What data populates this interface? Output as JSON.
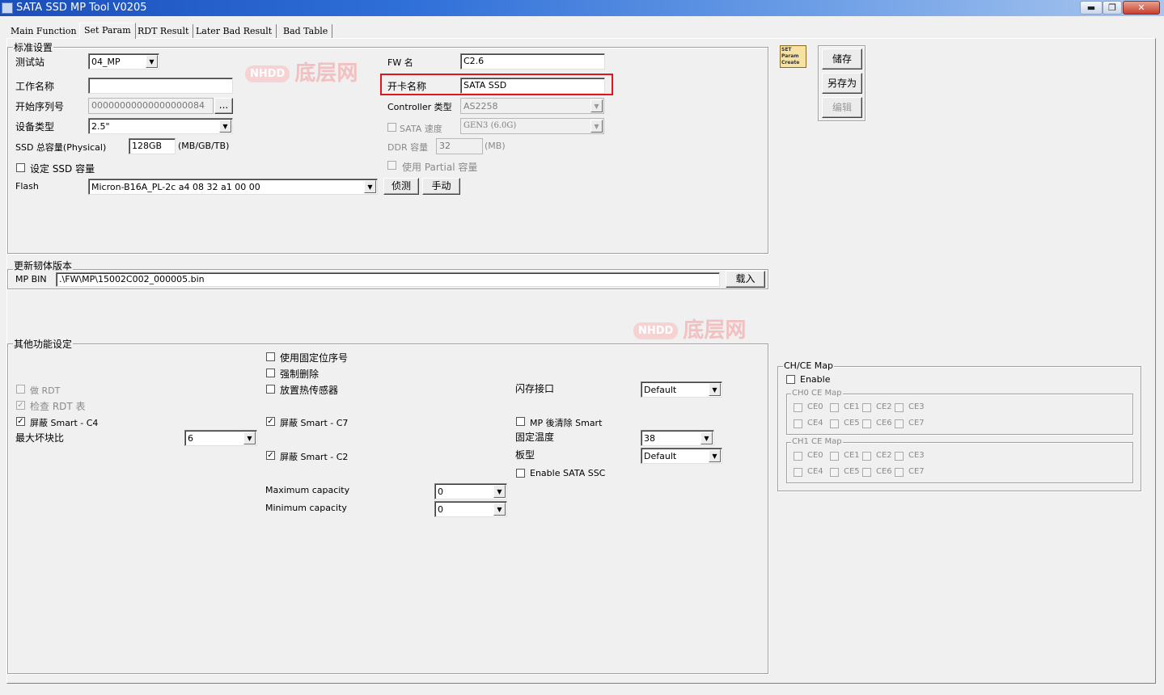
{
  "window": {
    "title": "SATA SSD MP Tool V0205",
    "minimize": "▬",
    "maximize": "❐",
    "close": "✕"
  },
  "tabs": [
    "Main Function",
    "Set Param",
    "RDT Result",
    "Later Bad Result",
    "Bad Table"
  ],
  "standard": {
    "legend": "标准设置",
    "station_label": "测试站",
    "station_value": "04_MP",
    "work_name_label": "工作名称",
    "work_name_value": "",
    "serial_label": "开始序列号",
    "serial_value": "00000000000000000084",
    "serial_browse": "...",
    "device_type_label": "设备类型",
    "device_type_value": "2.5\"",
    "capacity_label": "SSD 总容量(Physical)",
    "capacity_value": "128GB",
    "capacity_unit": "(MB/GB/TB)",
    "set_capacity_label": "设定 SSD 容量",
    "flash_label": "Flash",
    "flash_value": "Micron-B16A_PL-2c a4 08 32 a1 00 00",
    "detect_button": "侦测",
    "manual_button": "手动",
    "fw_name_label": "FW 名",
    "fw_name_value": "C2.6",
    "card_name_label": "开卡名称",
    "card_name_value": "SATA SSD",
    "controller_label": "Controller 类型",
    "controller_value": "AS2258",
    "sata_speed_label": "SATA 速度",
    "sata_speed_value": "GEN3 (6.0G)",
    "ddr_label": "DDR 容量",
    "ddr_value": "32",
    "ddr_unit": "(MB)",
    "partial_label": "使用 Partial 容量"
  },
  "firmware": {
    "legend": "更新韧体版本",
    "mp_bin_label": "MP BIN",
    "mp_bin_value": ".\\FW\\MP\\15002C002_000005.bin",
    "load_button": "载入"
  },
  "other": {
    "legend": "其他功能设定",
    "fixed_serial": "使用固定位序号",
    "force_delete": "强制删除",
    "thermal_sensor": "放置热传感器",
    "do_rdt": "做 RDT",
    "check_rdt": "检查 RDT 表",
    "mask_c4": "屏蔽 Smart - C4",
    "mask_c7": "屏蔽 Smart - C7",
    "mask_c2": "屏蔽 Smart - C2",
    "max_bad_label": "最大坏块比",
    "max_bad_value": "6",
    "flash_if_label": "闪存接口",
    "flash_if_value": "Default",
    "mp_clear_smart": "MP 後清除 Smart",
    "fixed_temp_label": "固定温度",
    "fixed_temp_value": "38",
    "board_label": "板型",
    "board_value": "Default",
    "sata_ssc": "Enable SATA SSC",
    "max_cap_label": "Maximum capacity",
    "max_cap_value": "0",
    "min_cap_label": "Minimum capacity",
    "min_cap_value": "0"
  },
  "side_buttons": {
    "save": "储存",
    "save_as": "另存为",
    "edit": "编辑"
  },
  "logo_text": "SET Param Create",
  "chce": {
    "legend": "CH/CE Map",
    "enable": "Enable",
    "ch0_legend": "CH0 CE Map",
    "ch1_legend": "CH1 CE Map",
    "ces": [
      "CE0",
      "CE1",
      "CE2",
      "CE3",
      "CE4",
      "CE5",
      "CE6",
      "CE7"
    ]
  },
  "watermark": {
    "badge": "NHDD",
    "text": "底层网"
  }
}
